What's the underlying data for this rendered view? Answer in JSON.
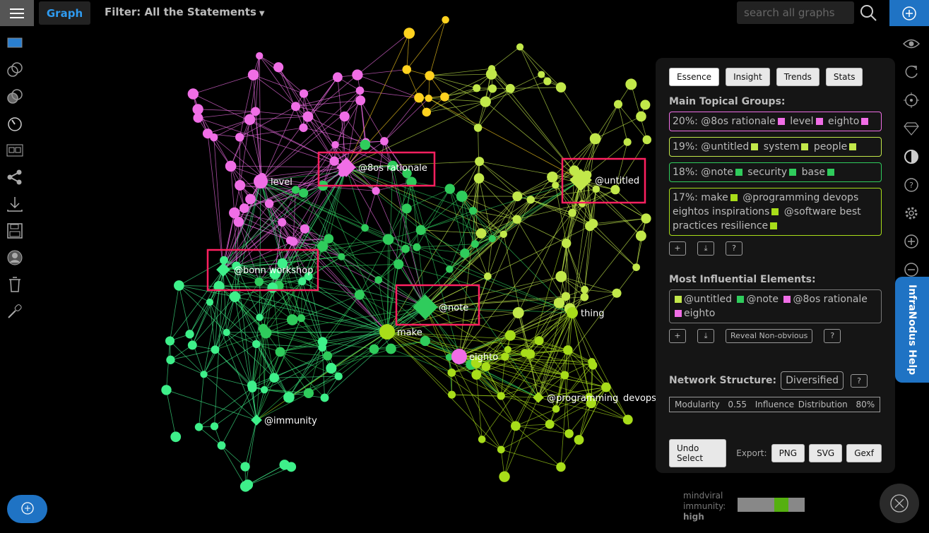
{
  "header": {
    "tab": "Graph",
    "filter": "Filter: All the Statements",
    "search_placeholder": "search all graphs"
  },
  "sidebar_icons": [
    "window-icon",
    "overlap-icon",
    "overlap-filled-icon",
    "timer-icon",
    "film-icon",
    "share-icon",
    "download-icon",
    "save-icon",
    "user-icon",
    "trash-icon",
    "microphone-icon"
  ],
  "right_icons": [
    "eye-icon",
    "refresh-icon",
    "target-icon",
    "diamond-icon",
    "contrast-icon",
    "help-icon",
    "gear-icon",
    "zoom-in-icon",
    "zoom-out-icon"
  ],
  "colors": {
    "pink": "#f06ee6",
    "lime": "#c2e84a",
    "green": "#2fcc5c",
    "mint": "#3ef08a",
    "yellow": "#ffd21f",
    "accent": "#1f73c4",
    "highlight": "#ff2060"
  },
  "graph": {
    "labels": [
      "@8os rationale",
      "@untitled",
      "level",
      "@bonn workshop",
      "@note",
      "make",
      "thing",
      "eighto",
      "@programming",
      "devops",
      "eightos inspirations",
      "@immunity"
    ],
    "highlighted": [
      "@8os rationale",
      "@untitled",
      "@bonn workshop",
      "@note"
    ]
  },
  "panel": {
    "tabs": [
      "Essence",
      "Insight",
      "Trends",
      "Stats"
    ],
    "groups_title": "Main Topical Groups:",
    "groups": [
      {
        "percent": "20%:",
        "items": [
          "@8os rationale",
          "level",
          "eighto"
        ],
        "color": "#f06ee6"
      },
      {
        "percent": "19%:",
        "items": [
          "@untitled",
          "system",
          "people"
        ],
        "color": "#c2e84a"
      },
      {
        "percent": "18%:",
        "items": [
          "@note",
          "security",
          "base"
        ],
        "color": "#2fcc5c"
      },
      {
        "percent": "17%:",
        "items": [
          "make",
          "@programming devops eightos inspirations",
          "@software best practices resilience"
        ],
        "color": "#a8dd1a"
      }
    ],
    "plus": "+",
    "download": "⤓",
    "help": "?",
    "influential_title": "Most Influential Elements:",
    "influential": [
      {
        "label": "@untitled",
        "color": "#c2e84a"
      },
      {
        "label": "@note",
        "color": "#2fcc5c"
      },
      {
        "label": "@8os rationale",
        "color": "#f06ee6"
      },
      {
        "label": "eighto",
        "color": "#f06ee6"
      }
    ],
    "reveal": "Reveal Non-obvious",
    "structure_title": "Network Structure:",
    "structure": "Diversified",
    "modularity_label": "Modularity",
    "modularity": "0.55",
    "influence_label": "Influence Distribution",
    "influence": "80%",
    "undo": "Undo Select",
    "export_label": "Export:",
    "exports": [
      "PNG",
      "SVG",
      "Gexf"
    ]
  },
  "help_tab": "InfraNodus Help",
  "mindviral": {
    "label1": "mindviral",
    "label2": "immunity:",
    "level": "high",
    "position": 0.55
  }
}
